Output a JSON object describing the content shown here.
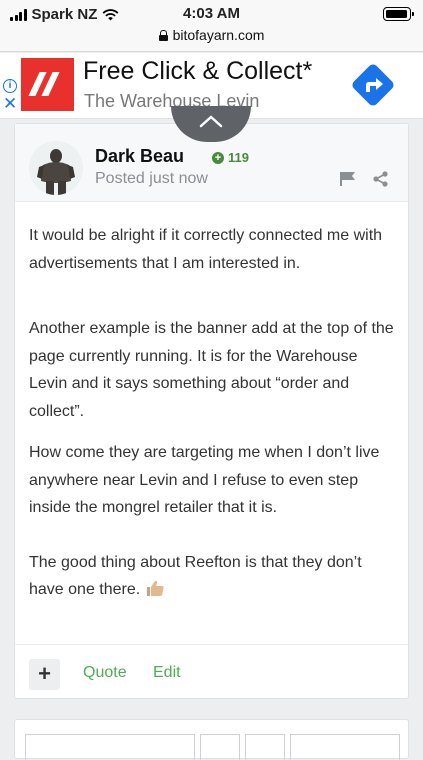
{
  "status_bar": {
    "carrier": "Spark NZ",
    "time": "4:03 AM"
  },
  "url_bar": {
    "domain": "bitofayarn.com"
  },
  "ad": {
    "title": "Free Click & Collect*",
    "subtitle": "The Warehouse Levin",
    "info_glyph": "i",
    "close_glyph": "✕",
    "brand_color": "#e8302c",
    "link_color": "#1a73e8"
  },
  "post": {
    "author": "Dark Beau",
    "reputation": "119",
    "posted": "Posted just now",
    "paragraphs": [
      "It would be alright if it correctly connected me with advertisements that I am interested in.",
      "Another example is the banner add at the top of the page currently running. It is for the Warehouse Levin and it says something about “order and collect”.",
      "How come they are targeting me when I don’t live anywhere near Levin and I refuse to even step inside the mongrel retailer that it is.",
      "The good thing about Reefton is that they don’t have one there."
    ],
    "actions": {
      "plus": "+",
      "quote": "Quote",
      "edit": "Edit"
    },
    "colors": {
      "reputation": "#4a8a3c",
      "action": "#4caf50"
    }
  }
}
